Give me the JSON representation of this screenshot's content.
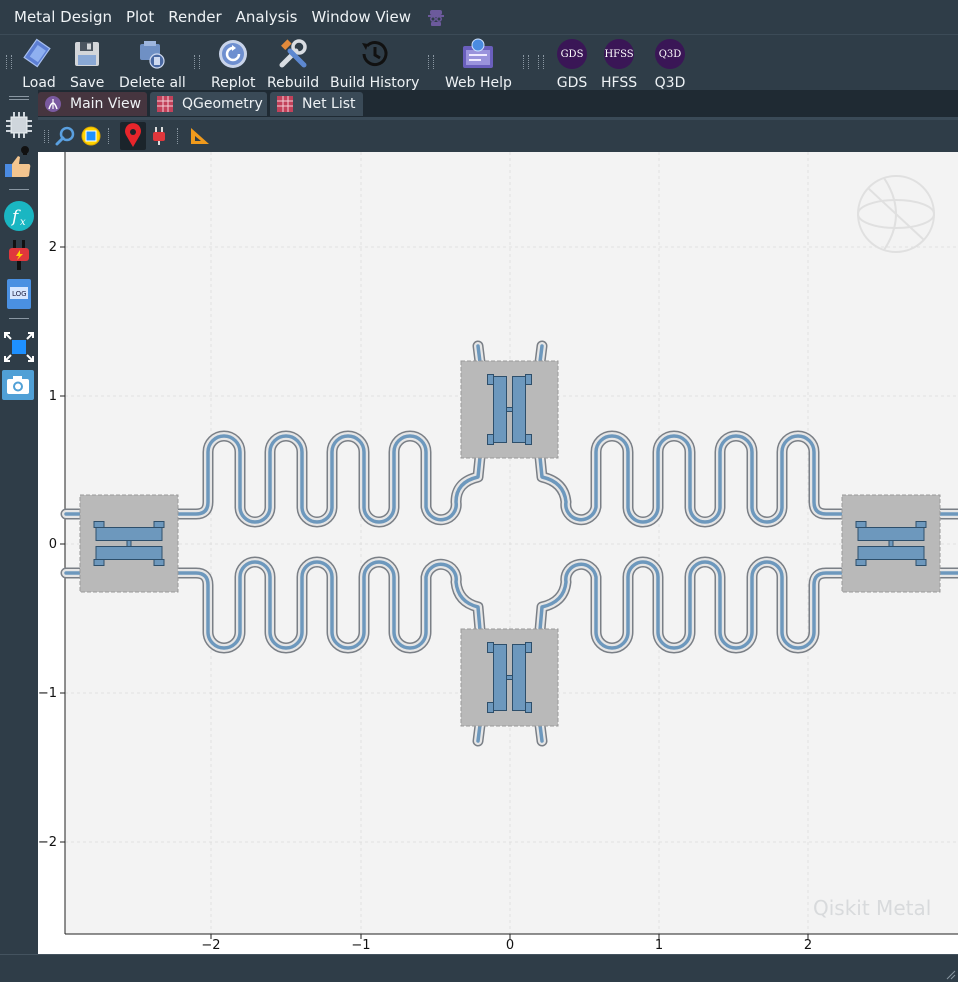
{
  "menu": [
    "Metal Design",
    "Plot",
    "Render",
    "Analysis",
    "Window View"
  ],
  "toolbar": {
    "load": "Load",
    "save": "Save",
    "delete_all": "Delete all",
    "replot": "Replot",
    "rebuild": "Rebuild",
    "build_history": "Build History",
    "web_help": "Web Help",
    "gds": "GDS",
    "hfss": "HFSS",
    "q3d": "Q3D"
  },
  "tabs": [
    "Main View",
    "QGeometry",
    "Net List"
  ],
  "plot": {
    "x_ticks": [
      "−2",
      "−1",
      "0",
      "1",
      "2"
    ],
    "y_ticks": [
      "2",
      "1",
      "0",
      "−1",
      "−2"
    ],
    "watermark": "Qiskit Metal"
  },
  "colors": {
    "ui_bg": "#2f3d48",
    "pad_gray": "#b9b9b9",
    "metal_blue": "#6d98bd",
    "accent_purple": "#3a1656"
  },
  "icons": {
    "left_sidebar": [
      "chip-icon",
      "thumbs-up-wrench-icon",
      "fx-icon",
      "plug-icon",
      "log-icon",
      "fit-view-icon",
      "camera-icon"
    ],
    "subtools": [
      "zoom-icon",
      "select-icon",
      "pin-icon",
      "plug-small-icon",
      "ruler-icon"
    ]
  }
}
